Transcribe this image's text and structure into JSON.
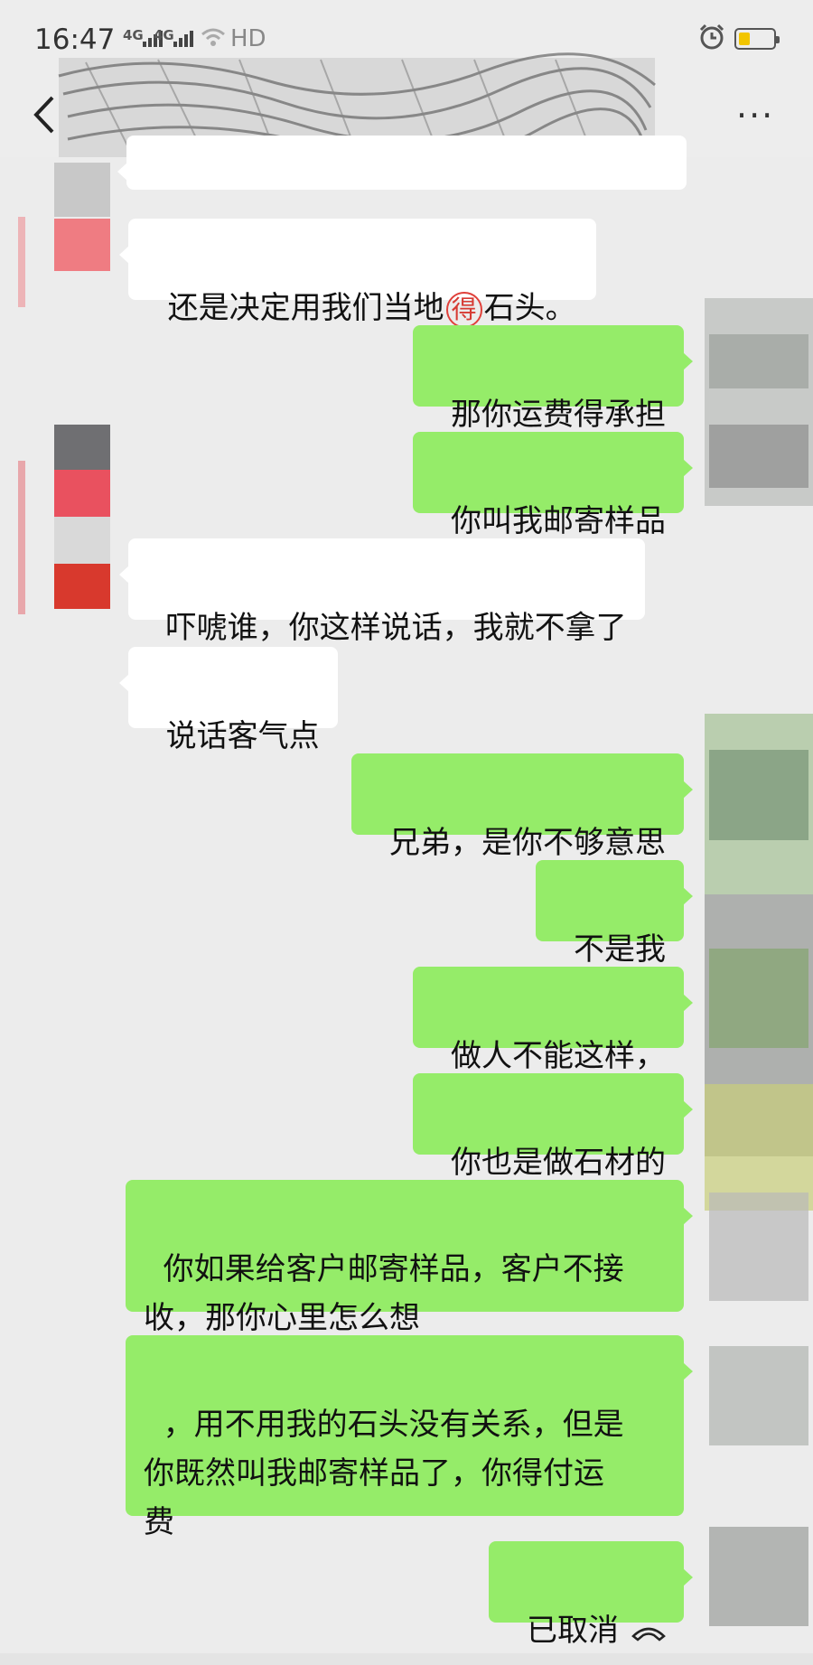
{
  "status_bar": {
    "time": "16:47",
    "network_1": "4G",
    "network_2": "4G",
    "hd": "HD",
    "battery_icon": "battery-low-icon",
    "alarm_icon": "alarm-clock-icon"
  },
  "title_bar": {
    "back_icon": "back-arrow-icon",
    "more_icon": "more-dots-icon",
    "more": "···"
  },
  "colors": {
    "background": "#ececec",
    "incoming_bubble": "#ffffff",
    "outgoing_bubble": "#95ec69",
    "circled_char": "#e0403a"
  },
  "messages": [
    {
      "side": "in",
      "text": "还是决定用我们当地",
      "circled": "得",
      "text_after": "石头。"
    },
    {
      "side": "out",
      "text": "那你运费得承担"
    },
    {
      "side": "out",
      "text": "你叫我邮寄样品"
    },
    {
      "side": "in",
      "text": "吓唬谁，你这样说话，我就不拿了"
    },
    {
      "side": "in",
      "text": "说话客气点"
    },
    {
      "side": "out",
      "text": "兄弟，是你不够意思"
    },
    {
      "side": "out",
      "text": "不是我"
    },
    {
      "side": "out",
      "text": "做人不能这样，"
    },
    {
      "side": "out",
      "text": "你也是做石材的"
    },
    {
      "side": "out",
      "text": "你如果给客户邮寄样品，客户不接\n收，那你心里怎么想"
    },
    {
      "side": "out",
      "text": "，用不用我的石头没有关系，但是\n你既然叫我邮寄样品了，你得付运\n费"
    },
    {
      "side": "out",
      "text": "已取消",
      "icon": "phone-hangup-icon"
    }
  ]
}
